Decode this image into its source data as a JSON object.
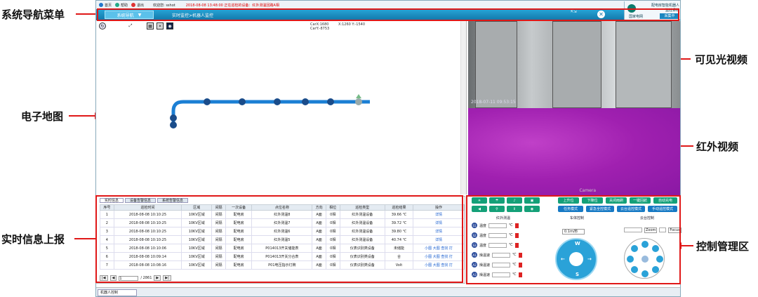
{
  "annotations": {
    "nav_menu": "系统导航菜单",
    "e_map": "电子地图",
    "realtime_report": "实时信息上报",
    "visible_video": "可见光视频",
    "infrared_video": "红外视频",
    "control_area": "控制管理区"
  },
  "topbar": {
    "home": "首页",
    "help": "帮助",
    "logout": "退出",
    "welcome": "欢迎您: sshot",
    "alarm": "2018-08-08 13:48:00 正在巡检的设备：红外测温回路A相"
  },
  "navbar": {
    "menu_label": "系统导航",
    "breadcrumb": "实时监控>机器人监控"
  },
  "logo": {
    "title_line1": "配电房智能机器人",
    "title_line2": "监控系统",
    "brand": "国家电网",
    "button": "采集中"
  },
  "map": {
    "car_x": "CarX:1680",
    "car_y": "CarY:-8753",
    "cursor": "X:1260 Y:-1540"
  },
  "video": {
    "timestamp": "2018-07-11 09:53:15",
    "camera_label": "Camera"
  },
  "info_tabs": [
    "实时信息",
    "设备告警信息",
    "系统告警信息"
  ],
  "table": {
    "headers": [
      "序号",
      "巡检时间",
      "区域",
      "间隔",
      "一次设备",
      "点位名称",
      "方向",
      "相位",
      "巡检类型",
      "巡检结果",
      "操作"
    ],
    "rows": [
      [
        "1",
        "2018-08-08 10:10:25",
        "10KV区域",
        "间隔",
        "配电房",
        "红外测温8",
        "A面",
        "0相",
        "红外测温设备",
        "39.66 ℃",
        "详情"
      ],
      [
        "2",
        "2018-08-08 10:10:25",
        "10KV区域",
        "间隔",
        "配电房",
        "红外测温7",
        "A面",
        "0相",
        "红外测温设备",
        "39.72 ℃",
        "详情"
      ],
      [
        "3",
        "2018-08-08 10:10:25",
        "10KV区域",
        "间隔",
        "配电房",
        "红外测温6",
        "A面",
        "0相",
        "红外测温设备",
        "39.80 ℃",
        "详情"
      ],
      [
        "4",
        "2018-08-08 10:10:25",
        "10KV区域",
        "间隔",
        "配电房",
        "红外测温5",
        "A面",
        "0相",
        "红外测温设备",
        "40.74 ℃",
        "详情"
      ],
      [
        "5",
        "2018-08-08 10:10:06",
        "10KV区域",
        "间隔",
        "配电房",
        "P014013开关储能表",
        "A面",
        "0相",
        "仪表识别类设备",
        "未储能",
        "小图 大图 查找 打"
      ],
      [
        "6",
        "2018-08-08 10:09:14",
        "10KV区域",
        "间隔",
        "配电房",
        "P014013开关分合表",
        "A面",
        "0相",
        "仪表识别类设备",
        "合",
        "小图 大图 查找 打"
      ],
      [
        "7",
        "2018-08-08 10:08:16",
        "10KV区域",
        "间隔",
        "配电房",
        "P01电压指示灯牌",
        "A面",
        "0相",
        "仪表识别类设备",
        "Volt",
        "小图 大图 查找 打"
      ]
    ]
  },
  "pager": {
    "page": "1",
    "total": "/ 2861"
  },
  "status_tab": "机器人控制",
  "control": {
    "row1": [
      "上升位",
      "下降位",
      "关闭雨刷",
      "一键回航",
      "自动充电"
    ],
    "row2": [
      "任务模式",
      "紧急全控模式",
      "云台遥控模式",
      "手动遥控模式"
    ],
    "sec_ir": "红外测温",
    "sec_car": "车体控制",
    "sec_ptz": "云台控制",
    "sensors": [
      {
        "id": "S1",
        "label": "温度",
        "unit": "℃"
      },
      {
        "id": "S2",
        "label": "温度",
        "unit": "℃"
      },
      {
        "id": "S3",
        "label": "温度",
        "unit": "℃"
      },
      {
        "id": "A1",
        "label": "燥温速",
        "unit": "℃"
      },
      {
        "id": "A2",
        "label": "燥温速",
        "unit": "℃"
      },
      {
        "id": "A3",
        "label": "燥温速",
        "unit": "℃"
      }
    ],
    "speed_select": "0.1m/秒",
    "zoom": "Zoom",
    "focus": "Focus",
    "dirs": {
      "n": "W",
      "s": "S"
    }
  }
}
